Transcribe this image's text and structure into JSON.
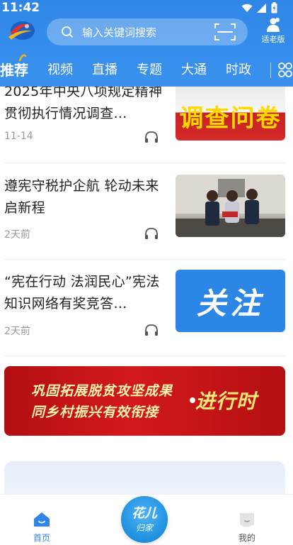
{
  "status_bar": {
    "time": "11:42"
  },
  "header": {
    "search_placeholder": "输入关键词搜索",
    "elder_mode_label": "适老版",
    "accent": "#2f86e6"
  },
  "tabs": [
    {
      "label": "推荐",
      "active": true
    },
    {
      "label": "视频",
      "active": false
    },
    {
      "label": "直播",
      "active": false
    },
    {
      "label": "专题",
      "active": false
    },
    {
      "label": "大通",
      "active": false
    },
    {
      "label": "时政",
      "active": false
    }
  ],
  "feed": {
    "articles": [
      {
        "title": "2025年中央八项规定精神贯彻执行情况调查…",
        "date": "11-14",
        "thumb_text": "调查问卷"
      },
      {
        "title": "遵宪守税护企航 轮动未来启新程",
        "date": "2天前",
        "thumb_text": ""
      },
      {
        "title": "“宪在行动 法润民心”宪法知识网络有奖竞答…",
        "date": "2天前",
        "thumb_text": "关注"
      }
    ],
    "banner": {
      "line1": "巩固拓展脱贫攻坚成果",
      "line2": "同乡村振兴有效衔接",
      "tag": "进行时"
    }
  },
  "bottom_nav": {
    "home_label": "首页",
    "center_line1": "花儿",
    "center_line2": "归家",
    "mine_label": "我的"
  }
}
